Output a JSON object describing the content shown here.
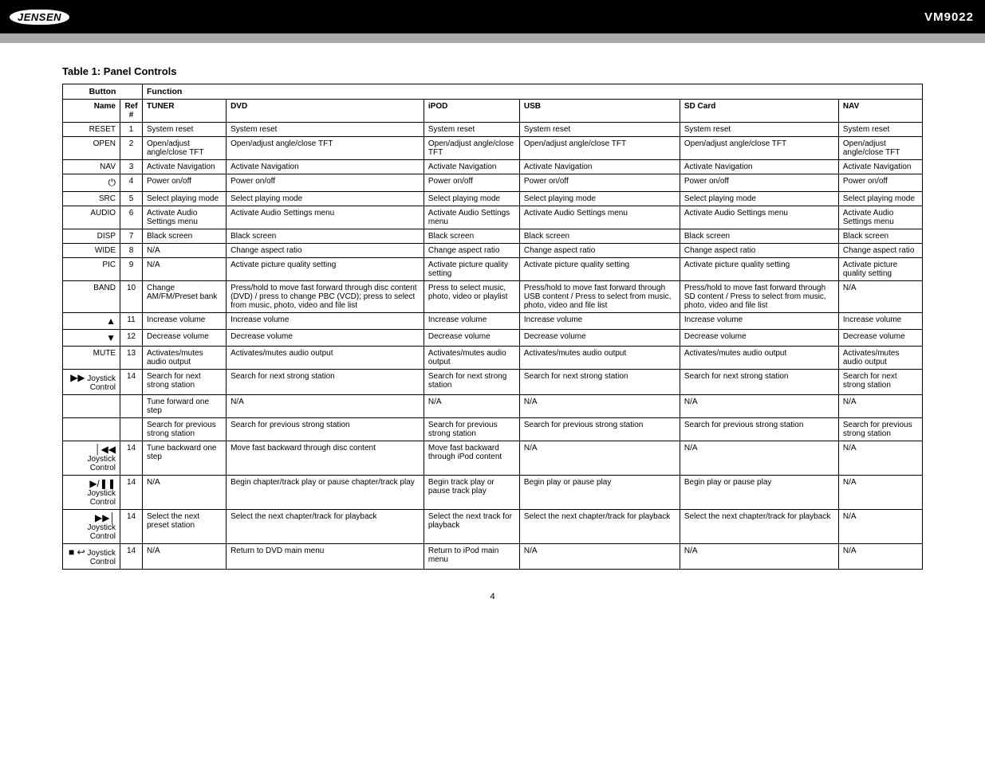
{
  "header": {
    "logo": "JENSEN",
    "model": "VM9022"
  },
  "title": "Table 1: Panel Controls",
  "tableHeader": {
    "button": "Button",
    "function": "Function",
    "name": "Name",
    "ref": "Ref #",
    "modes": [
      "TUNER",
      "DVD",
      "iPOD",
      "USB",
      "SD Card",
      "NAV"
    ]
  },
  "rows": [
    {
      "name": "RESET",
      "ref": "1",
      "cells": [
        "System reset",
        "System reset",
        "System reset",
        "System reset",
        "System reset",
        "System reset"
      ]
    },
    {
      "name": "OPEN",
      "ref": "2",
      "cells": [
        "Open/adjust angle/close TFT",
        "Open/adjust angle/close TFT",
        "Open/adjust angle/close TFT",
        "Open/adjust angle/close TFT",
        "Open/adjust angle/close TFT",
        "Open/adjust angle/close TFT"
      ]
    },
    {
      "name": "NAV",
      "ref": "3",
      "cells": [
        "Activate Navigation",
        "Activate Navigation",
        "Activate Navigation",
        "Activate Navigation",
        "Activate Navigation",
        "Activate Navigation"
      ]
    },
    {
      "name": "__PWR__",
      "ref": "4",
      "cells": [
        "Power on/off",
        "Power on/off",
        "Power on/off",
        "Power on/off",
        "Power on/off",
        "Power on/off"
      ]
    },
    {
      "name": "SRC",
      "ref": "5",
      "cells": [
        "Select playing mode",
        "Select playing mode",
        "Select playing mode",
        "Select playing mode",
        "Select playing mode",
        "Select playing mode"
      ]
    },
    {
      "name": "AUDIO",
      "ref": "6",
      "cells": [
        "Activate Audio Settings menu",
        "Activate Audio Settings menu",
        "Activate Audio Settings menu",
        "Activate Audio Settings menu",
        "Activate Audio Settings menu",
        "Activate Audio Settings menu"
      ]
    },
    {
      "name": "DISP",
      "ref": "7",
      "cells": [
        "Black screen",
        "Black screen",
        "Black screen",
        "Black screen",
        "Black screen",
        "Black screen"
      ]
    },
    {
      "name": "WIDE",
      "ref": "8",
      "cells": [
        "N/A",
        "Change aspect ratio",
        "Change aspect ratio",
        "Change aspect ratio",
        "Change aspect ratio",
        "Change aspect ratio"
      ]
    },
    {
      "name": "PIC",
      "ref": "9",
      "cells": [
        "N/A",
        "Activate picture quality setting",
        "Activate picture quality setting",
        "Activate picture quality setting",
        "Activate picture quality setting",
        "Activate picture quality setting"
      ]
    },
    {
      "name": "BAND",
      "ref": "10",
      "cells": [
        "Change AM/FM/Preset bank",
        "Press/hold to move fast forward through disc content (DVD) / press to change PBC (VCD); press to select from music, photo, video and file list",
        "Press to select music, photo, video or playlist",
        "Press/hold to move fast forward through USB content / Press to select from music, photo, video and file list",
        "Press/hold to move fast forward through SD content / Press to select from music, photo, video and file list",
        "N/A"
      ]
    },
    {
      "name": "__UP__",
      "ref": "11",
      "cells": [
        "Increase volume",
        "Increase volume",
        "Increase volume",
        "Increase volume",
        "Increase volume",
        "Increase volume"
      ]
    },
    {
      "name": "__DOWN__",
      "ref": "12",
      "cells": [
        "Decrease volume",
        "Decrease volume",
        "Decrease volume",
        "Decrease volume",
        "Decrease volume",
        "Decrease volume"
      ]
    },
    {
      "name": "MUTE",
      "ref": "13",
      "cells": [
        "Activates/mutes audio output",
        "Activates/mutes audio output",
        "Activates/mutes audio output",
        "Activates/mutes audio output",
        "Activates/mutes audio output",
        "Activates/mutes audio output"
      ]
    },
    {
      "name": "__FF__ Joystick Control",
      "ref": "14",
      "cells": [
        "Search for next strong station",
        "Search for next strong station",
        "Search for next strong station",
        "Search for next strong station",
        "Search for next strong station",
        "Search for next strong station"
      ]
    },
    {
      "name": "",
      "ref": "",
      "cells": [
        "Tune forward one step",
        "N/A",
        "N/A",
        "N/A",
        "N/A",
        "N/A"
      ]
    },
    {
      "name": "",
      "ref": "",
      "cells": [
        "Search for previous strong station",
        "Search for previous strong station",
        "Search for previous strong station",
        "Search for previous strong station",
        "Search for previous strong station",
        "Search for previous strong station"
      ]
    },
    {
      "name": "__RW__ Joystick Control",
      "ref": "14",
      "cells": [
        "Tune backward one step",
        "Move fast backward through disc content",
        "Move fast backward through iPod content",
        "N/A",
        "N/A",
        "N/A"
      ]
    },
    {
      "name": "__PLAYPAUSE__ Joystick Control",
      "ref": "14",
      "cells": [
        "N/A",
        "Begin chapter/track play or pause chapter/track play",
        "Begin track play or pause track play",
        "Begin play or pause play",
        "Begin play or pause play",
        "N/A"
      ]
    },
    {
      "name": "__NEXT__ Joystick Control",
      "ref": "14",
      "cells": [
        "Select the next preset station",
        "Select the next chapter/track for playback",
        "Select the next track for playback",
        "Select the next chapter/track for playback",
        "Select the next chapter/track for playback",
        "N/A"
      ]
    },
    {
      "name": "__STOPRET__ Joystick Control",
      "ref": "14",
      "cells": [
        "N/A",
        "Return to DVD main menu",
        "Return to iPod main menu",
        "N/A",
        "N/A",
        "N/A"
      ]
    }
  ],
  "pagenum": "4"
}
